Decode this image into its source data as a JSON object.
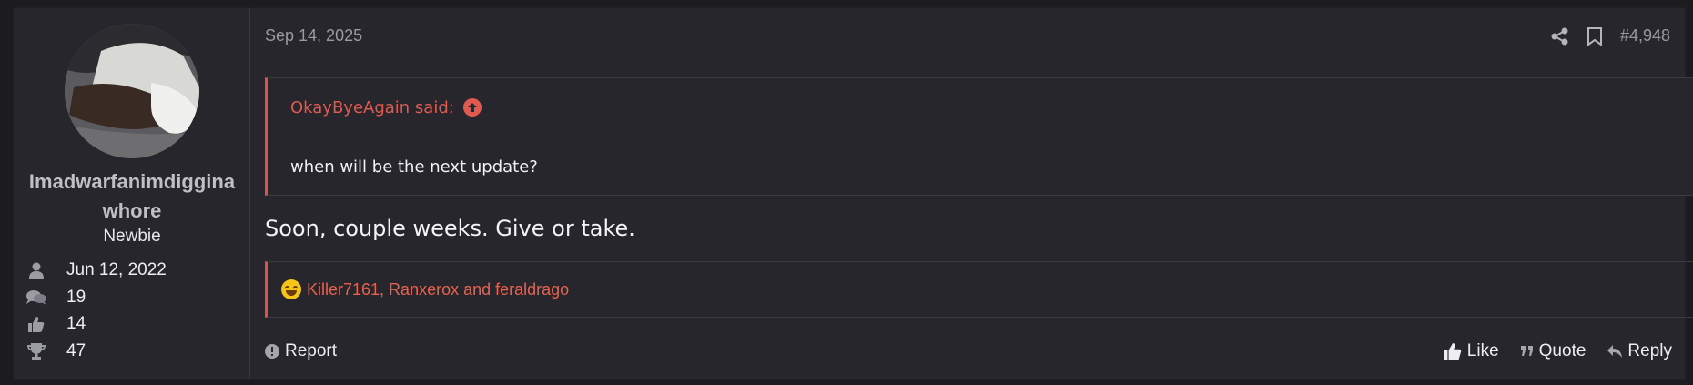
{
  "post": {
    "date": "Sep 14, 2025",
    "post_number": "#4,948",
    "message": "Soon, couple weeks. Give or take."
  },
  "user": {
    "name_line1": "Imadwarfanimdiggina",
    "name_line2": "whore",
    "title": "Newbie",
    "joined": "Jun 12, 2022",
    "messages": "19",
    "reactions": "14",
    "points": "47"
  },
  "quote": {
    "author_said": "OkayByeAgain said:",
    "text": "when will be the next update?"
  },
  "reactions_bar": {
    "users": "Killer7161, Ranxerox and feraldrago"
  },
  "footer": {
    "report": "Report",
    "like": "Like",
    "quote": "Quote",
    "reply": "Reply"
  },
  "icons": [
    "user-icon",
    "comments-icon",
    "thumbs-up-icon",
    "trophy-icon",
    "share-icon",
    "bookmark-icon",
    "arrow-up-icon",
    "laughing-emoji-icon",
    "warning-icon",
    "quote-icon",
    "reply-icon"
  ],
  "colors": {
    "accent": "#e05a4f",
    "background": "#26262c",
    "page": "#1b1b20"
  }
}
